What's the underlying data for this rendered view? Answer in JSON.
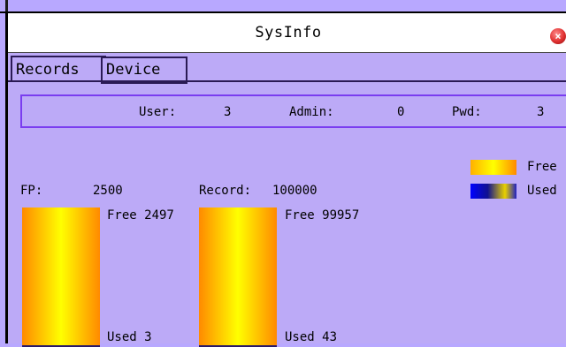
{
  "window": {
    "title": "SysInfo"
  },
  "tabs": [
    {
      "label": "Records",
      "active": true
    },
    {
      "label": "Device",
      "active": false
    }
  ],
  "stats": {
    "user_label": "User:",
    "user_value": "3",
    "admin_label": "Admin:",
    "admin_value": "0",
    "pwd_label": "Pwd:",
    "pwd_value": "3"
  },
  "legend": {
    "free_label": "Free",
    "used_label": "Used"
  },
  "fp": {
    "label": "FP:",
    "capacity": "2500",
    "free_text": "Free 2497",
    "used_text": "Used 3",
    "used_fraction": 0.0012
  },
  "record": {
    "label": "Record:",
    "capacity": "100000",
    "free_text": "Free 99957",
    "used_text": "Used 43",
    "used_fraction": 0.00043
  },
  "colors": {
    "background": "#bcaaf7",
    "box_border": "#7a3df0",
    "free_gradient": "#ffff00",
    "used_fill": "#2a1a6a"
  }
}
